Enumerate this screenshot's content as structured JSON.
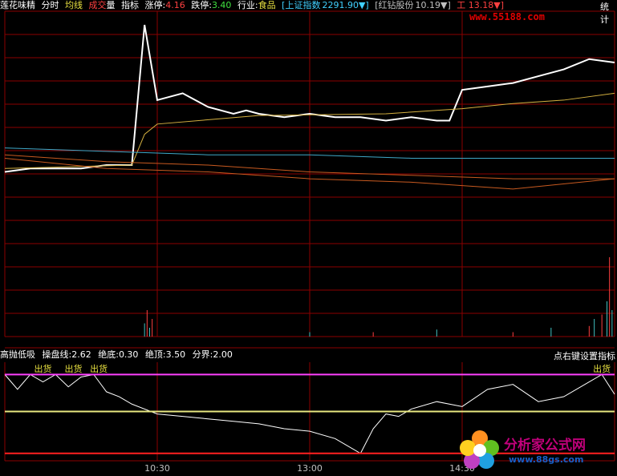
{
  "header": {
    "stock_name": "莲花味精",
    "mode": "分时",
    "avg_line": "均线",
    "volume_prefix": "成交",
    "volume_suffix": "量",
    "indicator": "指标",
    "limit_up_label": "涨停:",
    "limit_up_value": "4.16",
    "limit_down_label": "跌停:",
    "limit_down_value": "3.40",
    "industry_label": "行业:",
    "industry_value": "食品",
    "index_name": "[上证指数",
    "index_value": "2291.90▼]",
    "peer_name": "[红钻股份",
    "peer_value": "10.19▼]",
    "peer2_value": "工 13.18▼]",
    "stats_button": "统计"
  },
  "watermark_top": "www.55188.com",
  "sub_header": {
    "title": "高抛低吸",
    "line1_label": "操盘线:",
    "line1_value": "2.62",
    "line2_label": "绝底:",
    "line2_value": "0.30",
    "line3_label": "绝顶:",
    "line3_value": "3.50",
    "line4_label": "分界:",
    "line4_value": "2.00",
    "tip": "点右键设置指标"
  },
  "logo": {
    "text": "分析家公式网",
    "url": "www.88gs.com"
  },
  "colors": {
    "grid": "#8b0000",
    "price": "#ffffff",
    "avg": "#d4b040",
    "cyan": "#3fa8c8",
    "orange": "#c85a20",
    "magenta": "#ff40ff",
    "yellow_line": "#e8e880",
    "red_line": "#ff2020"
  },
  "chart_data": [
    {
      "type": "line",
      "name": "intraday",
      "series": [
        {
          "name": "price",
          "x": [
            0,
            10,
            20,
            30,
            40,
            50,
            55,
            60,
            70,
            80,
            90,
            95,
            100,
            110,
            120,
            130,
            140,
            150,
            160,
            170,
            175,
            180,
            190,
            200,
            210,
            220,
            230,
            240
          ],
          "y": [
            3.69,
            3.7,
            3.7,
            3.7,
            3.71,
            3.71,
            4.12,
            3.9,
            3.92,
            3.88,
            3.86,
            3.87,
            3.86,
            3.85,
            3.86,
            3.85,
            3.85,
            3.84,
            3.85,
            3.84,
            3.84,
            3.93,
            3.94,
            3.95,
            3.97,
            3.99,
            4.02,
            4.01
          ]
        },
        {
          "name": "avg",
          "x": [
            0,
            50,
            55,
            60,
            100,
            150,
            180,
            200,
            220,
            240
          ],
          "y": [
            3.7,
            3.71,
            3.8,
            3.83,
            3.855,
            3.86,
            3.875,
            3.89,
            3.9,
            3.92
          ]
        },
        {
          "name": "line3",
          "x": [
            0,
            40,
            80,
            120,
            160,
            200,
            240
          ],
          "y": [
            3.76,
            3.75,
            3.74,
            3.74,
            3.73,
            3.73,
            3.73
          ]
        },
        {
          "name": "line4",
          "x": [
            0,
            40,
            80,
            120,
            160,
            200,
            240
          ],
          "y": [
            3.74,
            3.72,
            3.71,
            3.69,
            3.68,
            3.67,
            3.67
          ]
        },
        {
          "name": "line5",
          "x": [
            0,
            40,
            80,
            120,
            160,
            200,
            240
          ],
          "y": [
            3.73,
            3.7,
            3.69,
            3.67,
            3.66,
            3.64,
            3.67
          ]
        }
      ],
      "ylim": [
        3.56,
        4.16
      ]
    },
    {
      "type": "line",
      "name": "indicator",
      "series": [
        {
          "name": "操盘线",
          "x": [
            0,
            5,
            10,
            15,
            20,
            25,
            30,
            35,
            40,
            45,
            50,
            60,
            70,
            80,
            90,
            100,
            110,
            120,
            130,
            140,
            145,
            150,
            155,
            160,
            170,
            180,
            190,
            200,
            210,
            220,
            230,
            235,
            240
          ],
          "y": [
            3.5,
            2.9,
            3.5,
            3.2,
            3.5,
            3.0,
            3.4,
            3.5,
            2.8,
            2.6,
            2.3,
            1.9,
            1.8,
            1.7,
            1.6,
            1.5,
            1.3,
            1.2,
            0.9,
            0.3,
            1.3,
            1.9,
            1.8,
            2.1,
            2.4,
            2.2,
            2.9,
            3.1,
            2.4,
            2.6,
            3.2,
            3.5,
            2.7
          ]
        },
        {
          "name": "绝顶",
          "x": [
            0,
            240
          ],
          "y": [
            3.5,
            3.5
          ]
        },
        {
          "name": "分界",
          "x": [
            0,
            240
          ],
          "y": [
            2.0,
            2.0
          ]
        },
        {
          "name": "绝底",
          "x": [
            0,
            240
          ],
          "y": [
            0.3,
            0.3
          ]
        }
      ],
      "annotations": [
        "出货",
        "出货",
        "出货",
        "出货"
      ],
      "ylim": [
        0,
        4
      ]
    }
  ],
  "time_labels": [
    "10:30",
    "13:00",
    "14:30"
  ]
}
